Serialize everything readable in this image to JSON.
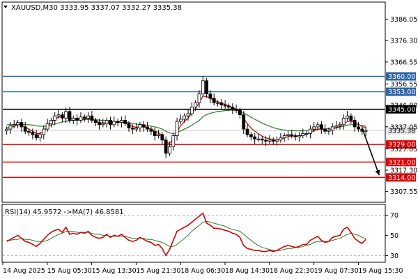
{
  "symbol_caption": "XAUUSD,M30  3333.95 3337.07 3332.27 3335.38",
  "rsi_caption": "RSI(14) 45.9572  ->MA(7) 46.8581",
  "colors": {
    "bull_candle": "#000000",
    "bear_candle": "#000000",
    "ma_fast": "#d40000",
    "ma_slow": "#2b7a2b",
    "rsi_line": "#d40000",
    "rsi_ma": "#2b7a2b",
    "resistance_blue": "#2e64a8",
    "black_level": "#000000",
    "support_red": "#e00000",
    "grid": "#d8d8d8"
  },
  "chart_data": [
    {
      "type": "candlestick",
      "title": "XAUUSD,M30",
      "ohlc_last": {
        "open": 3333.95,
        "high": 3337.07,
        "low": 3332.27,
        "close": 3335.38
      },
      "ylim": [
        3303.0,
        3393.5
      ],
      "y_ticks": [
        3386.05,
        3376.3,
        3366.55,
        3356.55,
        3346.8,
        3337.05,
        3327.05,
        3317.3,
        3307.55
      ],
      "x_tick_labels": [
        "14 Aug 2025",
        "15 Aug 05:30",
        "15 Aug 13:30",
        "15 Aug 21:30",
        "18 Aug 06:30",
        "18 Aug 14:30",
        "18 Aug 22:30",
        "19 Aug 07:30",
        "19 Aug 15:30"
      ],
      "levels": [
        {
          "value": 3360.0,
          "label": "3360.00",
          "color": "#2e64a8",
          "style": "blue-box"
        },
        {
          "value": 3353.0,
          "label": "3353.00",
          "color": "#2e64a8",
          "style": "blue-box"
        },
        {
          "value": 3345.0,
          "label": "3345.00",
          "color": "#000000",
          "style": "black-box"
        },
        {
          "value": 3329.0,
          "label": "3329.00",
          "color": "#e00000",
          "style": "red-box"
        },
        {
          "value": 3321.0,
          "label": "3321.00",
          "color": "#e00000",
          "style": "red-box"
        },
        {
          "value": 3314.0,
          "label": "3314.00",
          "color": "#e00000",
          "style": "red-box"
        }
      ],
      "current_price": {
        "value": 3335.38,
        "label": "3335.38"
      },
      "arrow": {
        "from_index": 96,
        "from_value": 3336.5,
        "to_index": 101,
        "to_value": 3315.0
      },
      "close": [
        3336.0,
        3337.5,
        3338.0,
        3339.0,
        3337.0,
        3335.0,
        3334.5,
        3333.5,
        3332.0,
        3333.5,
        3336.0,
        3338.5,
        3340.0,
        3342.0,
        3342.5,
        3341.0,
        3344.0,
        3340.0,
        3341.0,
        3340.0,
        3341.5,
        3341.0,
        3342.0,
        3340.0,
        3339.0,
        3338.0,
        3338.5,
        3340.0,
        3338.0,
        3339.5,
        3339.0,
        3340.0,
        3338.5,
        3336.5,
        3336.0,
        3336.5,
        3338.0,
        3337.0,
        3336.0,
        3335.0,
        3333.0,
        3333.5,
        3331.0,
        3325.0,
        3328.0,
        3333.0,
        3339.5,
        3340.5,
        3342.0,
        3343.0,
        3346.0,
        3348.0,
        3352.0,
        3358.0,
        3352.0,
        3350.0,
        3348.0,
        3348.0,
        3347.0,
        3346.5,
        3346.0,
        3345.0,
        3344.5,
        3342.5,
        3336.0,
        3333.5,
        3332.5,
        3331.5,
        3331.5,
        3331.0,
        3330.5,
        3331.0,
        3330.5,
        3331.0,
        3332.0,
        3333.0,
        3333.5,
        3333.0,
        3332.5,
        3333.0,
        3334.0,
        3334.0,
        3336.0,
        3337.0,
        3338.0,
        3336.0,
        3335.0,
        3335.5,
        3337.0,
        3337.5,
        3338.0,
        3341.0,
        3342.0,
        3340.0,
        3337.0,
        3336.0,
        3335.0,
        3335.38
      ],
      "ma_fast": [
        3336.5,
        3336.8,
        3337.2,
        3338.0,
        3337.8,
        3337.0,
        3336.0,
        3335.0,
        3334.0,
        3334.0,
        3335.0,
        3337.0,
        3339.0,
        3340.5,
        3341.5,
        3341.5,
        3341.8,
        3341.2,
        3340.8,
        3340.5,
        3340.6,
        3340.6,
        3340.9,
        3340.5,
        3339.8,
        3339.0,
        3338.8,
        3339.0,
        3338.8,
        3339.0,
        3339.0,
        3339.2,
        3338.8,
        3337.8,
        3337.2,
        3336.8,
        3337.0,
        3336.9,
        3336.5,
        3336.0,
        3335.0,
        3334.5,
        3333.0,
        3330.0,
        3329.5,
        3331.5,
        3335.0,
        3337.5,
        3339.5,
        3341.0,
        3343.5,
        3345.5,
        3348.0,
        3351.0,
        3350.8,
        3350.0,
        3349.0,
        3348.5,
        3347.8,
        3347.2,
        3346.6,
        3345.8,
        3345.0,
        3343.8,
        3341.0,
        3338.5,
        3336.5,
        3335.0,
        3333.8,
        3332.8,
        3332.0,
        3331.6,
        3331.2,
        3331.0,
        3331.4,
        3332.0,
        3332.6,
        3332.8,
        3332.8,
        3333.0,
        3333.4,
        3333.6,
        3334.4,
        3335.2,
        3336.0,
        3336.0,
        3335.6,
        3335.5,
        3336.0,
        3336.6,
        3337.2,
        3338.4,
        3339.4,
        3339.6,
        3339.0,
        3338.2,
        3337.2,
        3336.5
      ],
      "ma_slow": [
        3338.0,
        3338.0,
        3338.1,
        3338.2,
        3338.2,
        3338.1,
        3338.0,
        3337.8,
        3337.5,
        3337.3,
        3337.3,
        3337.5,
        3337.8,
        3338.3,
        3338.8,
        3339.2,
        3339.6,
        3339.8,
        3340.0,
        3340.1,
        3340.2,
        3340.3,
        3340.4,
        3340.4,
        3340.3,
        3340.1,
        3339.9,
        3339.8,
        3339.6,
        3339.5,
        3339.4,
        3339.3,
        3339.2,
        3338.9,
        3338.6,
        3338.3,
        3338.1,
        3337.9,
        3337.7,
        3337.4,
        3337.0,
        3336.6,
        3336.0,
        3335.0,
        3334.2,
        3334.0,
        3334.5,
        3335.2,
        3336.0,
        3336.8,
        3337.8,
        3338.8,
        3340.0,
        3341.6,
        3342.6,
        3343.2,
        3343.6,
        3344.0,
        3344.2,
        3344.4,
        3344.6,
        3344.6,
        3344.5,
        3344.2,
        3343.4,
        3342.4,
        3341.4,
        3340.5,
        3339.6,
        3338.8,
        3338.0,
        3337.3,
        3336.7,
        3336.2,
        3335.8,
        3335.6,
        3335.4,
        3335.3,
        3335.2,
        3335.2,
        3335.2,
        3335.3,
        3335.5,
        3335.7,
        3336.0,
        3336.1,
        3336.1,
        3336.2,
        3336.4,
        3336.6,
        3336.9,
        3337.3,
        3337.8,
        3338.0,
        3338.0,
        3337.9,
        3337.6,
        3337.3
      ]
    },
    {
      "type": "line",
      "title": "RSI(14)",
      "ylim": [
        24,
        80
      ],
      "y_ticks": [
        30,
        50,
        70
      ],
      "series": [
        {
          "name": "RSI(14)",
          "values": [
            44,
            46,
            48,
            50,
            47,
            44,
            43,
            41,
            39,
            42,
            46,
            50,
            53,
            55,
            56,
            53,
            58,
            51,
            52,
            51,
            53,
            52,
            54,
            50,
            48,
            47,
            48,
            51,
            48,
            50,
            49,
            51,
            48,
            45,
            44,
            45,
            48,
            46,
            44,
            43,
            40,
            41,
            37,
            30,
            36,
            45,
            54,
            56,
            58,
            60,
            63,
            66,
            69,
            72,
            62,
            60,
            57,
            57,
            56,
            55,
            54,
            52,
            51,
            48,
            40,
            37,
            36,
            35,
            35,
            34,
            34,
            35,
            34,
            35,
            37,
            39,
            40,
            39,
            38,
            39,
            41,
            41,
            45,
            47,
            49,
            45,
            43,
            44,
            48,
            49,
            50,
            56,
            58,
            53,
            47,
            44,
            42,
            45.9572
          ]
        },
        {
          "name": "MA(7)",
          "values": [
            45,
            45,
            46,
            46,
            47,
            46,
            46,
            45,
            44,
            44,
            44,
            45,
            47,
            49,
            51,
            52,
            54,
            54,
            54,
            53,
            53,
            53,
            53,
            52,
            51,
            51,
            50,
            50,
            49,
            49,
            49,
            49,
            49,
            48,
            47,
            47,
            47,
            47,
            46,
            46,
            45,
            44,
            43,
            41,
            39,
            39,
            41,
            44,
            47,
            50,
            54,
            57,
            60,
            63,
            64,
            63,
            62,
            61,
            60,
            59,
            57,
            56,
            55,
            54,
            51,
            48,
            45,
            42,
            40,
            38,
            37,
            36,
            35,
            35,
            35,
            36,
            37,
            37,
            38,
            38,
            39,
            40,
            41,
            43,
            44,
            44,
            44,
            44,
            45,
            46,
            47,
            49,
            51,
            52,
            51,
            50,
            48,
            46.8581
          ]
        }
      ]
    }
  ]
}
